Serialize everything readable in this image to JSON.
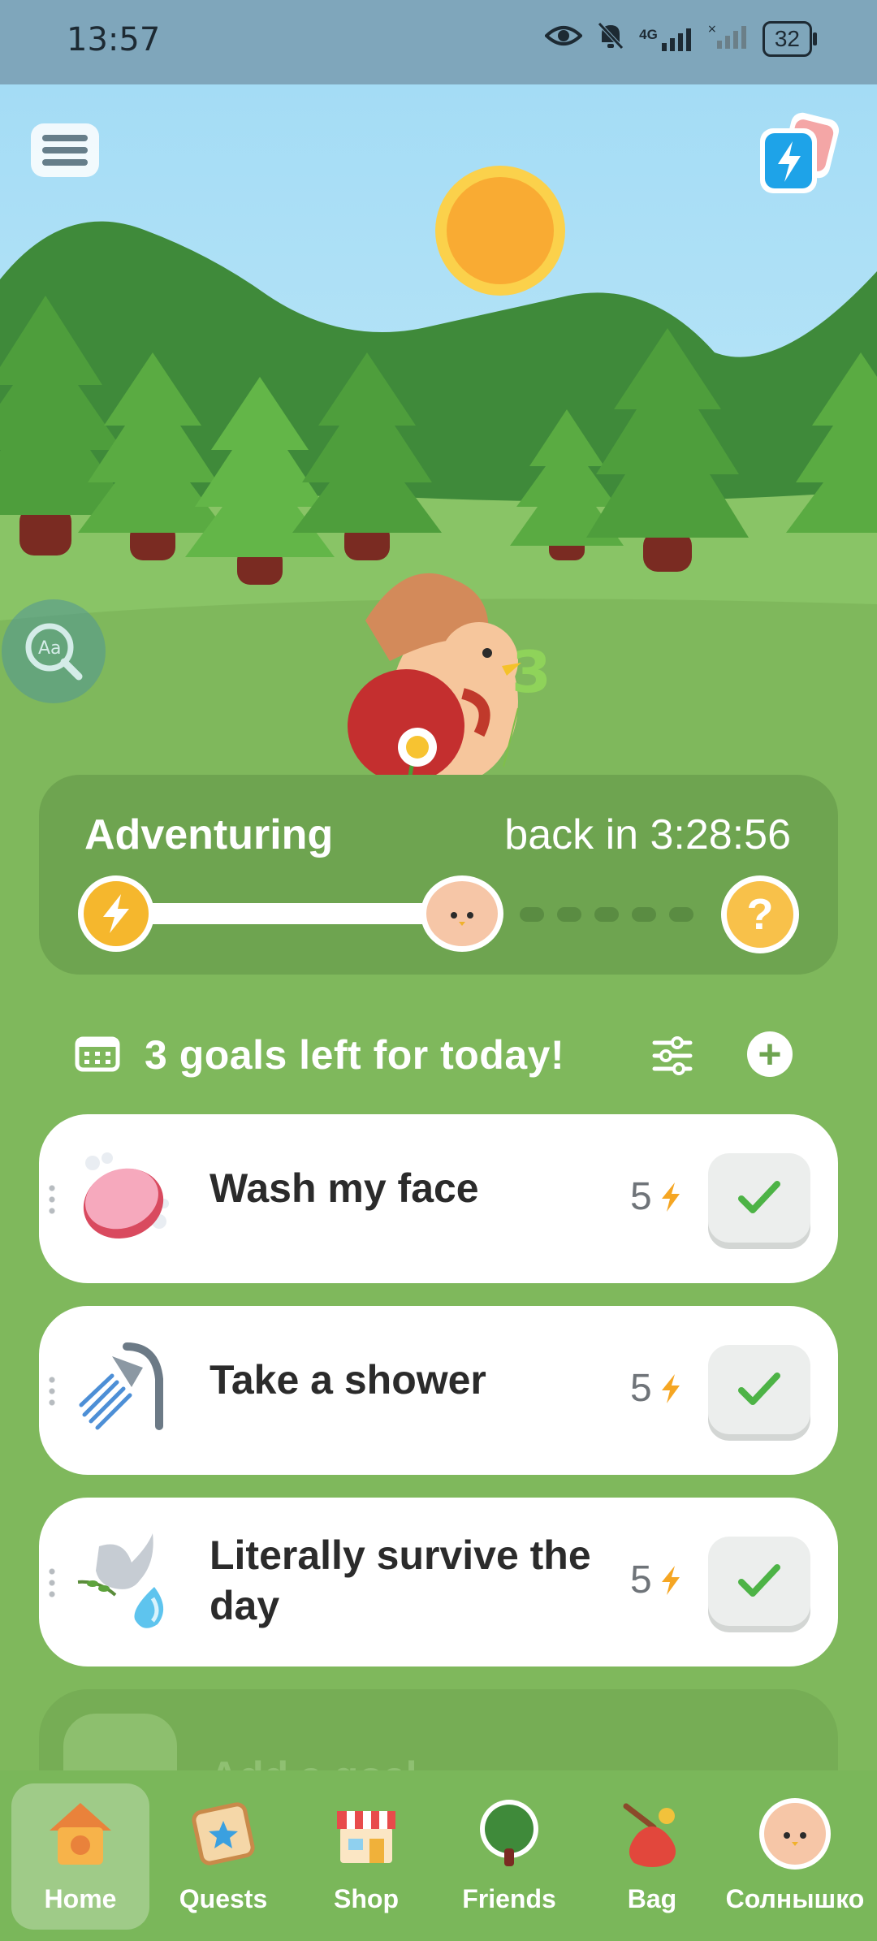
{
  "status_bar": {
    "time": "13:57",
    "network": "4G",
    "battery": "32"
  },
  "adventure": {
    "label": "Adventuring",
    "timer": "back in 3:28:56",
    "mystery_symbol": "?"
  },
  "goals_header": {
    "text": "3 goals left for today!",
    "add_symbol": "+"
  },
  "goals": [
    {
      "title": "Wash my face",
      "points": "5",
      "icon": "soap-icon"
    },
    {
      "title": "Take a shower",
      "points": "5",
      "icon": "shower-icon"
    },
    {
      "title": "Literally survive the day",
      "points": "5",
      "icon": "dove-icon"
    }
  ],
  "add_goal": {
    "label": "Add a goal"
  },
  "nav": [
    {
      "label": "Home",
      "icon": "home-icon",
      "active": true
    },
    {
      "label": "Quests",
      "icon": "quests-icon"
    },
    {
      "label": "Shop",
      "icon": "shop-icon"
    },
    {
      "label": "Friends",
      "icon": "tree-icon"
    },
    {
      "label": "Bag",
      "icon": "bag-icon"
    },
    {
      "label": "Солнышко",
      "icon": "pet-avatar"
    }
  ],
  "colors": {
    "grass": "#7fb85c",
    "sky": "#a9dcf2",
    "sun": "#f9ab33",
    "check": "#4db346",
    "bolt": "#f5a623"
  }
}
